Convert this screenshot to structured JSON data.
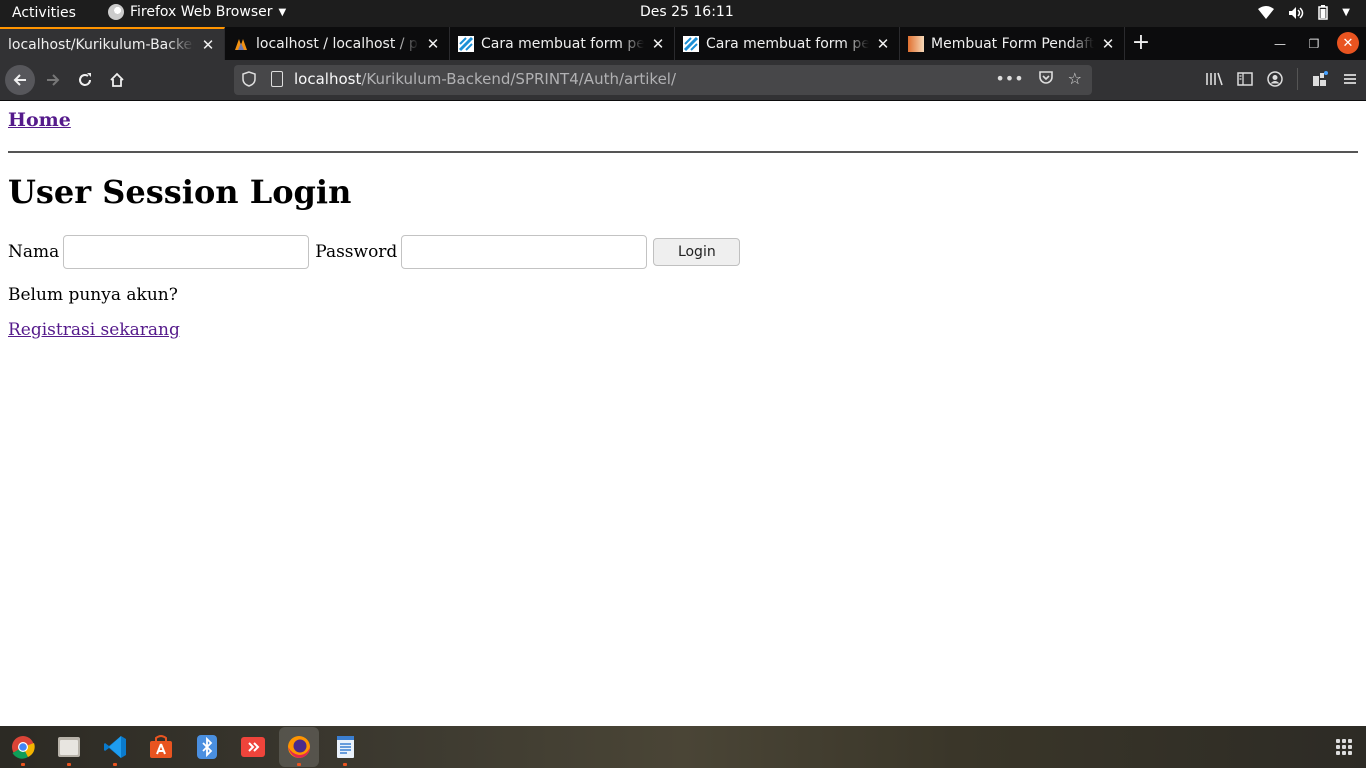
{
  "topbar": {
    "activities": "Activities",
    "app_name": "Firefox Web Browser",
    "clock": "Des 25  16:11"
  },
  "tabs": [
    {
      "title": "localhost/Kurikulum-Backend",
      "active": true
    },
    {
      "title": "localhost / localhost / po",
      "active": false
    },
    {
      "title": "Cara membuat form pen",
      "active": false
    },
    {
      "title": "Cara membuat form pen",
      "active": false
    },
    {
      "title": "Membuat Form Pendafta",
      "active": false
    }
  ],
  "urlbar": {
    "host": "localhost",
    "path": "/Kurikulum-Backend/SPRINT4/Auth/artikel/"
  },
  "page": {
    "home_link": "Home",
    "heading": "User Session Login",
    "nama_label": "Nama",
    "nama_value": "",
    "password_label": "Password",
    "password_value": "",
    "login_button": "Login",
    "no_account_text": "Belum punya akun?",
    "register_link": "Registrasi sekarang"
  },
  "dock": {
    "apps": [
      "chrome-icon",
      "files-icon",
      "vscode-icon",
      "software-icon",
      "bluetooth-icon",
      "anydesk-icon",
      "firefox-icon",
      "text-editor-icon"
    ]
  }
}
